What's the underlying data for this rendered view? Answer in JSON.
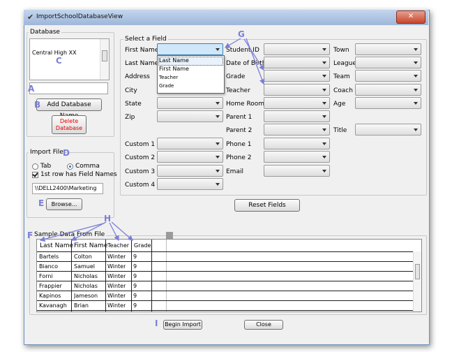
{
  "window": {
    "title": "ImportSchoolDatabaseView",
    "close_glyph": "✕"
  },
  "database": {
    "group_label": "Database",
    "items": [
      "Central High XX"
    ],
    "name_value": "",
    "add_button": "Add Database Name",
    "delete_button": "Delete Database"
  },
  "import_file": {
    "group_label": "Import File",
    "radio_tab": "Tab",
    "radio_comma": "Comma",
    "selected": "Comma",
    "checkbox_label": "1st row has Field Names",
    "checkbox_checked": true,
    "path_value": "\\\\DELL2400\\Marketing",
    "browse_button": "Browse..."
  },
  "select_field": {
    "group_label": "Select a Field",
    "col1": [
      "First Name",
      "Last Name",
      "Address",
      "City",
      "State",
      "Zip",
      "Custom 1",
      "Custom 2",
      "Custom 3",
      "Custom 4"
    ],
    "col2": [
      "Student ID",
      "Date of Birth",
      "Grade",
      "Teacher",
      "Home Room",
      "Parent 1",
      "Parent 2",
      "Phone 1",
      "Phone 2",
      "Email"
    ],
    "col3": [
      "Town",
      "League",
      "Team",
      "Coach",
      "Age",
      "Title"
    ],
    "dropdown_options": [
      "Last Name",
      "First Name",
      "Teacher",
      "Grade"
    ],
    "dropdown_selected": "Last Name",
    "reset_button": "Reset Fields"
  },
  "sample_data": {
    "group_label": "Sample Data From File",
    "headers": [
      "Last Name",
      "First Name",
      "Teacher",
      "Grade"
    ],
    "rows": [
      [
        "Bartels",
        "Colton",
        "Winter",
        "9"
      ],
      [
        "Bianco",
        "Samuel",
        "Winter",
        "9"
      ],
      [
        "Forni",
        "Nicholas",
        "Winter",
        "9"
      ],
      [
        "Frappier",
        "Nicholas",
        "Winter",
        "9"
      ],
      [
        "Kapinos",
        "Jameson",
        "Winter",
        "9"
      ],
      [
        "Kavanagh",
        "Brian",
        "Winter",
        "9"
      ]
    ]
  },
  "footer": {
    "begin_button": "Begin Import",
    "close_button": "Close"
  },
  "annotations": {
    "a": "A",
    "b": "B",
    "c": "C",
    "d": "D",
    "e": "E",
    "f": "F",
    "g": "G",
    "h": "H",
    "i": "I"
  },
  "colors": {
    "annotation": "#7b7fd6",
    "delete_text": "#e00000",
    "title_bar": "#9db6d9",
    "close_button": "#c7462d"
  }
}
